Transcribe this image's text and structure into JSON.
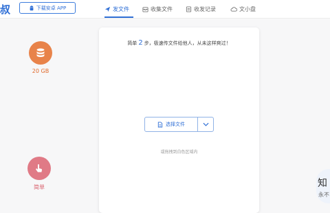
{
  "header": {
    "logo_fragment": "叔",
    "app_button_label": "下载安卓 APP",
    "tabs": [
      {
        "label": "发文件",
        "icon": "paper-plane-icon",
        "active": true
      },
      {
        "label": "收集文件",
        "icon": "collect-box-icon",
        "active": false
      },
      {
        "label": "收发记录",
        "icon": "record-list-icon",
        "active": false
      },
      {
        "label": "文小盘",
        "icon": "cloud-drive-icon",
        "active": false
      }
    ]
  },
  "features": [
    {
      "label": "20 GB",
      "icon": "database-icon",
      "color": "#e8834a"
    },
    {
      "label": "简单",
      "icon": "tap-hand-icon",
      "color": "#e07a86"
    }
  ],
  "upload_card": {
    "step_prefix": "简单",
    "step_number": "2",
    "step_suffix": "步，极速传文件给他人，从未这样爽过！",
    "choose_button_label": "选择文件",
    "drop_hint": "或拖拽到白色区域内"
  },
  "float_widget": {
    "line1": "知",
    "line2": "永不"
  },
  "colors": {
    "accent": "#2f6fd6",
    "storage_badge": "#e8834a",
    "simple_badge": "#e07a86"
  }
}
